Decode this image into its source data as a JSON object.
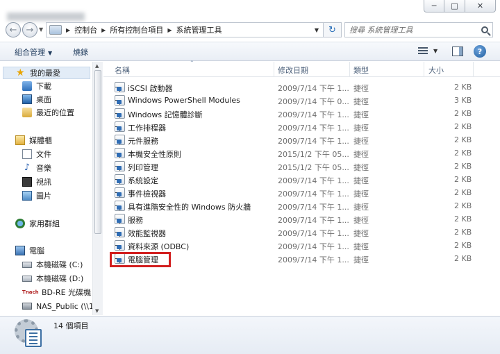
{
  "window": {
    "minimize_glyph": "─",
    "maximize_glyph": "□",
    "close_glyph": "✕"
  },
  "address": {
    "crumbs": [
      "控制台",
      "所有控制台項目",
      "系統管理工具"
    ],
    "search_placeholder": "搜尋 系統管理工具"
  },
  "toolbar": {
    "organize_label": "組合管理",
    "burn_label": "燒錄",
    "help_glyph": "?"
  },
  "nav": {
    "favorites": {
      "label": "我的最愛",
      "items": [
        "下載",
        "桌面",
        "最近的位置"
      ]
    },
    "libraries": {
      "label": "媒體櫃",
      "items": [
        "文件",
        "音樂",
        "視訊",
        "圖片"
      ]
    },
    "homegroup": {
      "label": "家用群組"
    },
    "computer": {
      "label": "電腦",
      "items": [
        "本機磁碟 (C:)",
        "本機磁碟 (D:)",
        "BD-RE 光碟機 (F",
        "NAS_Public (\\\\1"
      ]
    }
  },
  "columns": {
    "name": "名稱",
    "date": "修改日期",
    "type": "類型",
    "size": "大小"
  },
  "files": [
    {
      "name": "iSCSI 啟動器",
      "date": "2009/7/14 下午 1...",
      "type": "捷徑",
      "size": "2 KB"
    },
    {
      "name": "Windows PowerShell Modules",
      "date": "2009/7/14 下午 0...",
      "type": "捷徑",
      "size": "3 KB"
    },
    {
      "name": "Windows 記憶體診斷",
      "date": "2009/7/14 下午 1...",
      "type": "捷徑",
      "size": "2 KB"
    },
    {
      "name": "工作排程器",
      "date": "2009/7/14 下午 1...",
      "type": "捷徑",
      "size": "2 KB"
    },
    {
      "name": "元件服務",
      "date": "2009/7/14 下午 1...",
      "type": "捷徑",
      "size": "2 KB"
    },
    {
      "name": "本機安全性原則",
      "date": "2015/1/2 下午 05...",
      "type": "捷徑",
      "size": "2 KB"
    },
    {
      "name": "列印管理",
      "date": "2015/1/2 下午 05...",
      "type": "捷徑",
      "size": "2 KB"
    },
    {
      "name": "系統設定",
      "date": "2009/7/14 下午 1...",
      "type": "捷徑",
      "size": "2 KB"
    },
    {
      "name": "事件檢視器",
      "date": "2009/7/14 下午 1...",
      "type": "捷徑",
      "size": "2 KB"
    },
    {
      "name": "具有進階安全性的 Windows 防火牆",
      "date": "2009/7/14 下午 1...",
      "type": "捷徑",
      "size": "2 KB"
    },
    {
      "name": "服務",
      "date": "2009/7/14 下午 1...",
      "type": "捷徑",
      "size": "2 KB"
    },
    {
      "name": "效能監視器",
      "date": "2009/7/14 下午 1...",
      "type": "捷徑",
      "size": "2 KB"
    },
    {
      "name": "資料來源 (ODBC)",
      "date": "2009/7/14 下午 1...",
      "type": "捷徑",
      "size": "2 KB"
    },
    {
      "name": "電腦管理",
      "date": "2009/7/14 下午 1...",
      "type": "捷徑",
      "size": "2 KB"
    }
  ],
  "status": {
    "item_count": "14 個項目"
  },
  "colors": {
    "highlight": "#d21f1f",
    "header_text": "#4c607a",
    "toolbar_text": "#1e3a5c"
  }
}
